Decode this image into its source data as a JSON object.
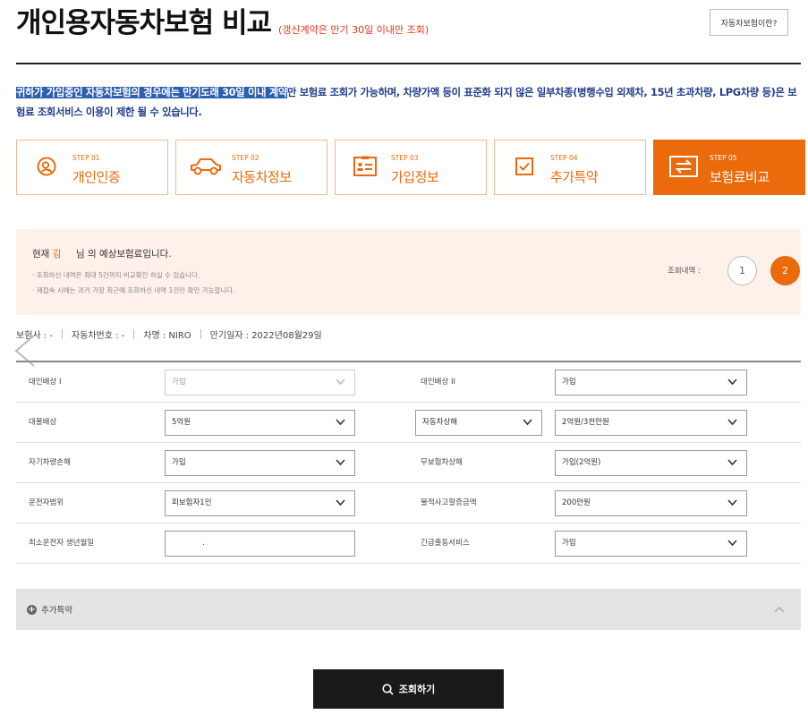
{
  "header": {
    "title": "개인용자동차보험 비교",
    "subtitle": "(갱신계약은 만기 30일 이내만 조회)",
    "about_button": "자동차보험이란?"
  },
  "notice": {
    "highlighted": "귀하가 가입중인 자동차보험의 경우에는 만기도래 30일 이내 계약",
    "rest": "만 보험료 조회가 가능하며, 차량가액 등이 표준화 되지 않은 일부차종(병행수입 외제차, 15년 초과차량, LPG차량 등)은 보험료 조회서비스 이용이 제한 될 수 있습니다."
  },
  "steps": [
    {
      "num": "STEP 01",
      "name": "개인인증",
      "icon": "person-check-icon",
      "active": false
    },
    {
      "num": "STEP 02",
      "name": "자동차정보",
      "icon": "car-icon",
      "active": false
    },
    {
      "num": "STEP 03",
      "name": "가입정보",
      "icon": "id-card-icon",
      "active": false
    },
    {
      "num": "STEP 04",
      "name": "추가특약",
      "icon": "checkbox-icon",
      "active": false
    },
    {
      "num": "STEP 05",
      "name": "보험료비교",
      "icon": "compare-icon",
      "active": true
    }
  ],
  "summary": {
    "prefix": "현재",
    "name": "김",
    "suffix": "님 의 예상보험료입니다.",
    "notes": [
      "· 조회하신 내역은 최대 5건까지 비교확인 하실 수 있습니다.",
      "· 재접속 시에는 과거 가장 최근에 조회하신 내역 1건만 확인 가능합니다."
    ],
    "history_label": "조회내역 :",
    "history_buttons": [
      "1",
      "2"
    ]
  },
  "car_info": [
    "보험사 : -",
    "자동차번호 : -",
    "차명 : NIRO",
    "만기일자 : 2022년08월29일"
  ],
  "form": {
    "rows": [
      {
        "left_label": "대인배상 I",
        "left_value": "가입",
        "right_label": "대인배상 II",
        "right_value": "가입"
      },
      {
        "left_label": "대물배상",
        "left_value": "5억원",
        "right_select": "자동차상해",
        "right_value": "2억원/3천만원"
      },
      {
        "left_label": "자기차량손해",
        "left_value": "가입",
        "right_label": "무보험차상해",
        "right_value": "가입(2억원)"
      },
      {
        "left_label": "운전자범위",
        "left_value": "피보험자1인",
        "right_label": "물적사고할증금액",
        "right_value": "200만원"
      },
      {
        "left_label": "최소운전자 생년월일",
        "left_value": ".",
        "right_label": "긴급출동서비스",
        "right_value": "가입"
      }
    ]
  },
  "extra": {
    "label": "추가특약"
  },
  "submit": {
    "label": "조회하기"
  },
  "colors": {
    "accent": "#ea6a0c",
    "notice": "#1f3c8c",
    "highlight": "#2c5fb0"
  }
}
